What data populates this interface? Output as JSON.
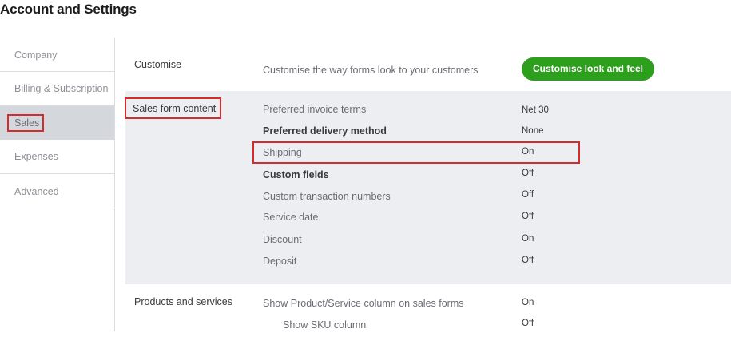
{
  "page": {
    "title": "Account and Settings"
  },
  "sidebar": {
    "items": [
      {
        "label": "Company"
      },
      {
        "label": "Billing & Subscription"
      },
      {
        "label": "Sales"
      },
      {
        "label": "Expenses"
      },
      {
        "label": "Advanced"
      }
    ],
    "active": "Sales"
  },
  "customise": {
    "section_label": "Customise",
    "description": "Customise the way forms look to your customers",
    "button_label": "Customise look and feel"
  },
  "sales_form_content": {
    "section_label": "Sales form content",
    "rows": [
      {
        "label": "Preferred invoice terms",
        "value": "Net 30"
      },
      {
        "label": "Preferred delivery method",
        "value": "None"
      },
      {
        "label": "Shipping",
        "value": "On"
      },
      {
        "label": "Custom fields",
        "value": "Off"
      },
      {
        "label": "Custom transaction numbers",
        "value": "Off"
      },
      {
        "label": "Service date",
        "value": "Off"
      },
      {
        "label": "Discount",
        "value": "On"
      },
      {
        "label": "Deposit",
        "value": "Off"
      }
    ]
  },
  "products_and_services": {
    "section_label": "Products and services",
    "rows": [
      {
        "label": "Show Product/Service column on sales forms",
        "value": "On"
      },
      {
        "label": "Show SKU column",
        "value": "Off"
      }
    ]
  },
  "colors": {
    "accent_green": "#2ca01c",
    "highlight_red": "#d52b2b",
    "section_bg": "#eceef1"
  }
}
